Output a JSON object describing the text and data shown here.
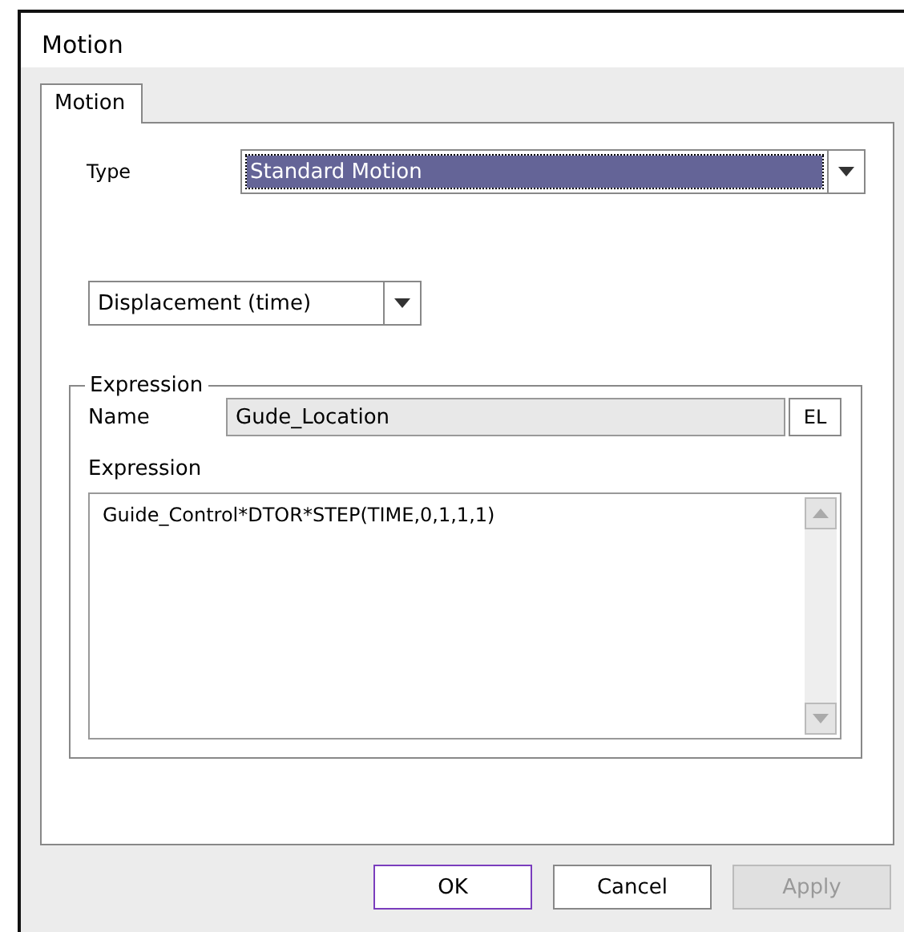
{
  "window": {
    "title": "Motion"
  },
  "tabs": [
    {
      "label": "Motion",
      "selected": true
    }
  ],
  "type_field": {
    "label": "Type",
    "value": "Standard Motion",
    "selected": true
  },
  "motion_kind": {
    "value": "Displacement (time)"
  },
  "expression_group": {
    "title": "Expression",
    "name_label": "Name",
    "name_value": "Gude_Location",
    "el_button": "EL",
    "expression_label": "Expression",
    "expression_value": "Guide_Control*DTOR*STEP(TIME,0,1,1,1)"
  },
  "buttons": [
    {
      "label": "OK",
      "focused": true,
      "disabled": false
    },
    {
      "label": "Cancel",
      "focused": false,
      "disabled": false
    },
    {
      "label": "Apply",
      "focused": false,
      "disabled": true
    }
  ]
}
